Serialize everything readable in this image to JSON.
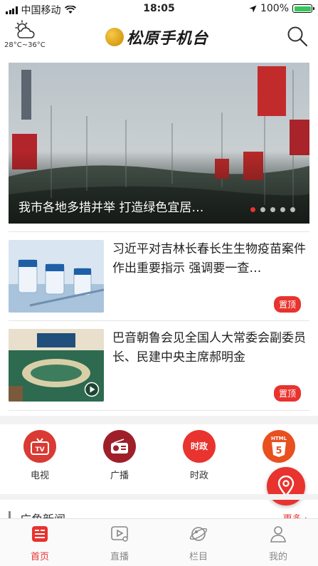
{
  "status_bar": {
    "carrier": "中国移动",
    "time": "18:05",
    "battery": "100%"
  },
  "header": {
    "temperature": "28°C~36°C",
    "logo_text": "松原手机台"
  },
  "banner": {
    "caption": "我市各地多措并举 打造绿色宜居…",
    "slide_count": 5,
    "active_slide": 1
  },
  "news": [
    {
      "title": "习近平对吉林长春长生生物疫苗案件作出重要指示 强调要一查…",
      "badge": "置顶",
      "has_video": false
    },
    {
      "title": "巴音朝鲁会见全国人大常委会副委员长、民建中央主席郝明金",
      "badge": "置顶",
      "has_video": true
    }
  ],
  "channels": [
    {
      "label": "电视",
      "icon": "tv-icon"
    },
    {
      "label": "广播",
      "icon": "radio-icon"
    },
    {
      "label": "时政",
      "icon": "politics-icon",
      "icon_text": "时政"
    },
    {
      "label": "",
      "icon": "html5-icon",
      "icon_text": "HTML"
    }
  ],
  "section": {
    "title": "广角新闻",
    "more": "更多 ›"
  },
  "tabs": [
    {
      "label": "首页",
      "icon": "home-news-icon",
      "active": true
    },
    {
      "label": "直播",
      "icon": "live-video-icon",
      "active": false
    },
    {
      "label": "栏目",
      "icon": "column-planet-icon",
      "active": false
    },
    {
      "label": "我的",
      "icon": "profile-icon",
      "active": false
    }
  ],
  "colors": {
    "accent": "#e8332e",
    "tv": "#d93a33",
    "radio": "#9e1f2a",
    "politics": "#e8332e",
    "html5": "#e8501f"
  }
}
